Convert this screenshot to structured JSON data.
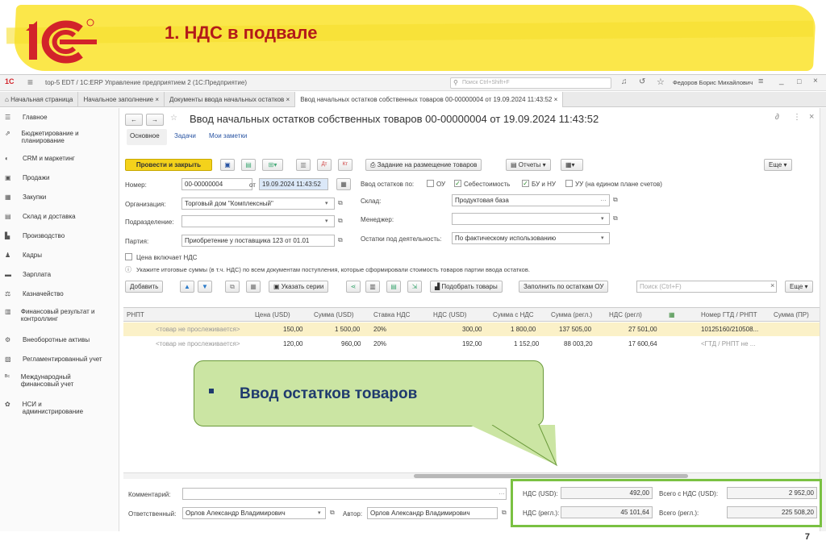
{
  "slide": {
    "title": "1. НДС в подвале",
    "page_number": "7"
  },
  "titlebar": {
    "app_title": "top-5 EDT / 1С:ERP Управление предприятием 2  (1С:Предприятие)",
    "search_placeholder": "Поиск Ctrl+Shift+F",
    "user": "Федоров Борис Михайлович"
  },
  "tabs": [
    {
      "label": "Начальная страница"
    },
    {
      "label": "Начальное заполнение"
    },
    {
      "label": "Документы ввода начальных остатков"
    },
    {
      "label": "Ввод начальных остатков собственных товаров 00-00000004 от 19.09.2024 11:43:52"
    }
  ],
  "sidebar": {
    "items": [
      {
        "label": "Главное",
        "icon": "menu-icon"
      },
      {
        "label": "Бюджетирование и планирование",
        "icon": "chart-icon"
      },
      {
        "label": "CRM и маркетинг",
        "icon": "crm-icon"
      },
      {
        "label": "Продажи",
        "icon": "cart-icon"
      },
      {
        "label": "Закупки",
        "icon": "basket-icon"
      },
      {
        "label": "Склад и доставка",
        "icon": "warehouse-icon"
      },
      {
        "label": "Производство",
        "icon": "factory-icon"
      },
      {
        "label": "Кадры",
        "icon": "people-icon"
      },
      {
        "label": "Зарплата",
        "icon": "salary-icon"
      },
      {
        "label": "Казначейство",
        "icon": "treasury-icon"
      },
      {
        "label": "Финансовый результат и контроллинг",
        "icon": "finance-icon"
      },
      {
        "label": "Внеоборотные активы",
        "icon": "assets-icon"
      },
      {
        "label": "Регламентированный учет",
        "icon": "book-icon"
      },
      {
        "label": "Международный финансовый учет",
        "icon": "intl-icon"
      },
      {
        "label": "НСИ и администрирование",
        "icon": "gear-icon"
      }
    ]
  },
  "doc": {
    "title": "Ввод начальных остатков собственных товаров 00-00000004 от 19.09.2024 11:43:52",
    "subtabs": [
      "Основное",
      "Задачи",
      "Мои заметки"
    ],
    "post_close": "Провести и закрыть",
    "task_btn": "Задание на размещение товаров",
    "reports_btn": "Отчеты",
    "more_btn": "Еще",
    "number_label": "Номер:",
    "number": "00-00000004",
    "date_label": "от",
    "date": "19.09.2024 11:43:52",
    "org_label": "Организация:",
    "org": "Торговый дом \"Комплексный\"",
    "dept_label": "Подразделение:",
    "batch_label": "Партия:",
    "batch": "Приобретение у поставщика 123 от 01.01",
    "price_incl_vat": "Цена включает НДС",
    "input_by_label": "Ввод остатков по:",
    "ou": "ОУ",
    "cost": "Себестоимость",
    "bu_nu": "БУ и НУ",
    "uu": "УУ (на едином плане счетов)",
    "warehouse_label": "Склад:",
    "warehouse": "Продуктовая база",
    "manager_label": "Менеджер:",
    "activity_label": "Остатки под деятельность:",
    "activity": "По фактическому использованию",
    "info": "Укажите итоговые суммы (в т.ч. НДС) по всем документам поступления, которые сформировали стоимость товаров партии ввода остатков.",
    "add_btn": "Добавить",
    "series_btn": "Указать серии",
    "pick_btn": "Подобрать товары",
    "fill_btn": "Заполнить по остаткам ОУ",
    "table_search_placeholder": "Поиск (Ctrl+F)"
  },
  "table": {
    "headers": [
      "РНПТ",
      "Цена (USD)",
      "Сумма (USD)",
      "Ставка НДС",
      "НДС (USD)",
      "Сумма с НДС",
      "Сумма (регл.)",
      "НДС (регл)",
      "",
      "Номер ГТД / РНПТ",
      "Сумма (ПР)"
    ],
    "rows": [
      [
        "<товар не прослеживается>",
        "150,00",
        "1 500,00",
        "20%",
        "300,00",
        "1 800,00",
        "137 505,00",
        "27 501,00",
        "",
        "10125160/210508...",
        ""
      ],
      [
        "<товар не прослеживается>",
        "120,00",
        "960,00",
        "20%",
        "192,00",
        "1 152,00",
        "88 003,20",
        "17 600,64",
        "",
        "<ГТД / РНПТ не ...",
        ""
      ]
    ]
  },
  "footer": {
    "comment_label": "Комментарий:",
    "resp_label": "Ответственный:",
    "resp": "Орлов Александр Владимирович",
    "author_label": "Автор:",
    "author": "Орлов Александр Владимирович",
    "vat_usd_label": "НДС (USD):",
    "vat_usd": "492,00",
    "total_usd_label": "Всего с НДС (USD):",
    "total_usd": "2 952,00",
    "vat_reg_label": "НДС (регл.):",
    "vat_reg": "45 101,64",
    "total_reg_label": "Всего (регл.):",
    "total_reg": "225 508,20"
  },
  "callout": {
    "text": "Ввод остатков товаров"
  }
}
